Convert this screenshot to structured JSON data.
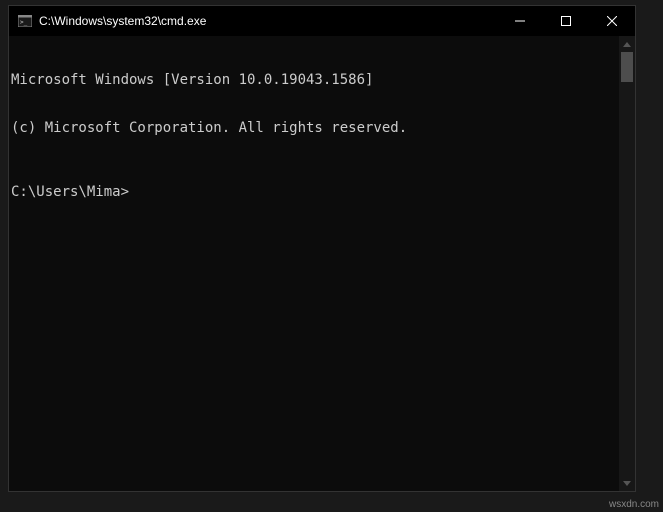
{
  "window": {
    "title": "C:\\Windows\\system32\\cmd.exe"
  },
  "terminal": {
    "line1": "Microsoft Windows [Version 10.0.19043.1586]",
    "line2": "(c) Microsoft Corporation. All rights reserved.",
    "prompt": "C:\\Users\\Mima>"
  },
  "watermark": "wsxdn.com"
}
